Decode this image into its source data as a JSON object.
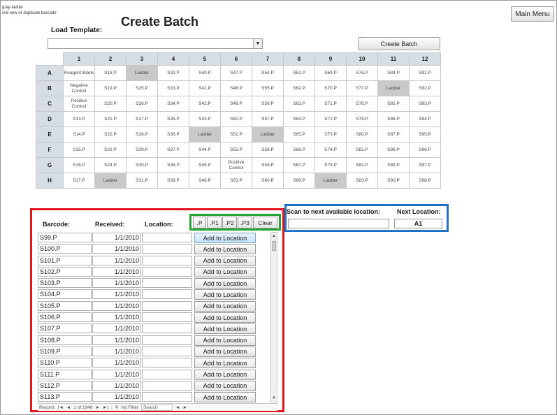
{
  "legend": {
    "line1": "gray-ladder",
    "line2": "red-new or duplicate barcode"
  },
  "header": {
    "title": "Create Batch",
    "main_menu_label": "Main Menu",
    "load_template_label": "Load Template:",
    "load_template_value": "",
    "create_batch_label": "Create Batch"
  },
  "plate": {
    "columns": [
      "1",
      "2",
      "3",
      "4",
      "5",
      "6",
      "7",
      "8",
      "9",
      "10",
      "11",
      "12"
    ],
    "rows": [
      "A",
      "B",
      "C",
      "D",
      "E",
      "F",
      "G",
      "H"
    ],
    "cells": [
      [
        "Reagent Blank",
        "S18.P",
        "Ladder",
        "S32.P",
        "S40.P",
        "S47.P",
        "S54.P",
        "S61.P",
        "S69.P",
        "S76.P",
        "S84.P",
        "S91.P"
      ],
      [
        "Negative Control",
        "S19.P",
        "S25.P",
        "S33.P",
        "S41.P",
        "S48.P",
        "S55.P",
        "S62.P",
        "S70.P",
        "S77.P",
        "Ladder",
        "S92.P"
      ],
      [
        "Positive Control",
        "S20.P",
        "S26.P",
        "S34.P",
        "S42.P",
        "S49.P",
        "S56.P",
        "S63.P",
        "S71.P",
        "S78.P",
        "S85.P",
        "S93.P"
      ],
      [
        "S13.P",
        "S21.P",
        "S27.P",
        "S35.P",
        "S43.P",
        "S50.P",
        "S57.P",
        "S64.P",
        "S72.P",
        "S79.P",
        "S86.P",
        "S94.P"
      ],
      [
        "S14.P",
        "S22.P",
        "S28.P",
        "S36.P",
        "Ladder",
        "S51.P",
        "Ladder",
        "S65.P",
        "S73.P",
        "S80.P",
        "S87.P",
        "S95.P"
      ],
      [
        "S15.P",
        "S23.P",
        "S29.P",
        "S37.P",
        "S44.P",
        "S52.P",
        "S58.P",
        "S66.P",
        "S74.P",
        "S81.P",
        "S88.P",
        "S96.P"
      ],
      [
        "S16.P",
        "S24.P",
        "S30.P",
        "S38.P",
        "S45.P",
        "Positive Control",
        "S59.P",
        "S67.P",
        "S75.P",
        "S82.P",
        "S89.P",
        "S97.P"
      ],
      [
        "S17.P",
        "Ladder",
        "S31.P",
        "S39.P",
        "S46.P",
        "S53.P",
        "S60.P",
        "S68.P",
        "Ladder",
        "S83.P",
        "S90.P",
        "S98.P"
      ]
    ]
  },
  "list": {
    "headers": {
      "barcode": "Barcode:",
      "received": "Received:",
      "location": "Location:"
    },
    "suffix_buttons": [
      ".P",
      ".P1",
      ".P2",
      ".P3",
      "Clear"
    ],
    "add_label": "Add to Location",
    "rows": [
      {
        "barcode": "S99.P",
        "received": "1/1/2010",
        "location": ""
      },
      {
        "barcode": "S100.P",
        "received": "1/1/2010",
        "location": ""
      },
      {
        "barcode": "S101.P",
        "received": "1/1/2010",
        "location": ""
      },
      {
        "barcode": "S102.P",
        "received": "1/1/2010",
        "location": ""
      },
      {
        "barcode": "S103.P",
        "received": "1/1/2010",
        "location": ""
      },
      {
        "barcode": "S104.P",
        "received": "1/1/2010",
        "location": ""
      },
      {
        "barcode": "S105.P",
        "received": "1/1/2010",
        "location": ""
      },
      {
        "barcode": "S106.P",
        "received": "1/1/2010",
        "location": ""
      },
      {
        "barcode": "S107.P",
        "received": "1/1/2010",
        "location": ""
      },
      {
        "barcode": "S108.P",
        "received": "1/1/2010",
        "location": ""
      },
      {
        "barcode": "S109.P",
        "received": "1/1/2010",
        "location": ""
      },
      {
        "barcode": "S110.P",
        "received": "1/1/2010",
        "location": ""
      },
      {
        "barcode": "S111.P",
        "received": "1/1/2010",
        "location": ""
      },
      {
        "barcode": "S112.P",
        "received": "1/1/2010",
        "location": ""
      },
      {
        "barcode": "S113.P",
        "received": "1/1/2010",
        "location": ""
      }
    ]
  },
  "scan": {
    "label": "Scan to next available location:",
    "next_label": "Next Location:",
    "next_value": "A1",
    "input_value": ""
  },
  "navbar": {
    "record_label": "Record:",
    "record_text": "1 of 1946",
    "filter_label": "No Filter",
    "search_label": "Search"
  }
}
